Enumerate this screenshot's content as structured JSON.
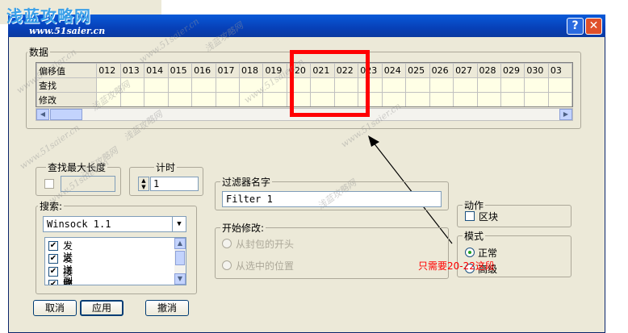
{
  "watermark": {
    "logo": "浅蓝攻略网",
    "url": "www.51saier.cn",
    "tile": "浅蓝攻略网"
  },
  "titlebar": {
    "help_glyph": "?",
    "close_glyph": "✕"
  },
  "data_group": {
    "label": "数据",
    "header_row_label": "偏移值",
    "rows": [
      "查找",
      "修改"
    ],
    "columns": [
      "012",
      "013",
      "014",
      "015",
      "016",
      "017",
      "018",
      "019",
      "020",
      "021",
      "022",
      "023",
      "024",
      "025",
      "026",
      "027",
      "028",
      "029",
      "030",
      "03"
    ]
  },
  "max_length": {
    "label": "查找最大长度",
    "checked": false,
    "value": ""
  },
  "timer": {
    "label": "计时",
    "value": "1"
  },
  "search": {
    "label": "搜索:",
    "selected": "Winsock 1.1",
    "items": [
      {
        "label": "发送",
        "checked": true
      },
      {
        "label": "发送到",
        "checked": true
      },
      {
        "label": "接收",
        "checked": true
      },
      {
        "label": "接收到",
        "checked": true
      }
    ]
  },
  "filter": {
    "label": "过滤器名字",
    "value": "Filter 1"
  },
  "start_modify": {
    "label": "开始修改:",
    "options": [
      "从封包的开头",
      "从选中的位置"
    ]
  },
  "action": {
    "label": "动作",
    "checkbox_label": "区块"
  },
  "mode": {
    "label": "模式",
    "options": [
      "正常",
      "高级"
    ]
  },
  "buttons": {
    "cancel": "取消",
    "apply": "应用",
    "revoke": "撤消"
  },
  "annotation": {
    "text": "只需要20-22这段",
    "color": "#ff0000"
  }
}
